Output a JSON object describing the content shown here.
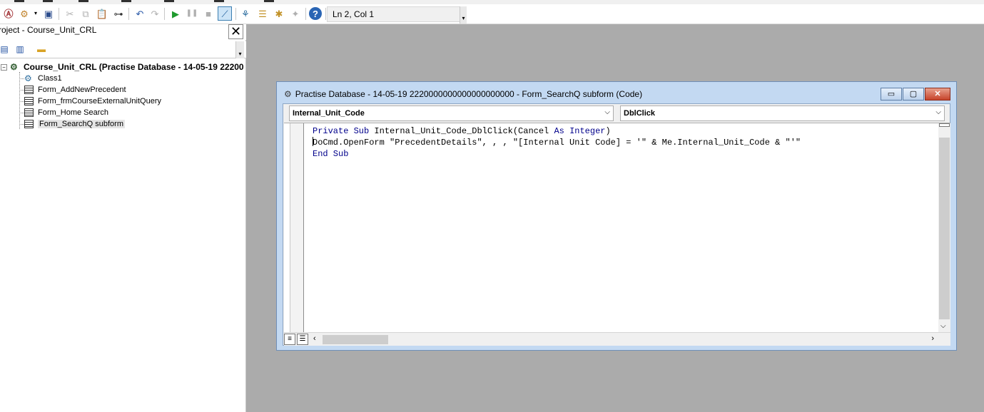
{
  "toolbar": {
    "buttons": [
      "access-icon",
      "insert-module-icon",
      "save-icon",
      "cut-icon",
      "copy-icon",
      "paste-icon",
      "find-icon",
      "undo-icon",
      "redo-icon",
      "run-icon",
      "break-icon",
      "reset-icon",
      "design-mode-icon",
      "project-explorer-icon",
      "properties-icon",
      "object-browser-icon",
      "toolbox-icon",
      "help-icon"
    ],
    "status": "Ln 2, Col 1"
  },
  "project": {
    "title": "roject - Course_Unit_CRL",
    "close_glyph": "✕",
    "root_label": "Course_Unit_CRL (Practise Database - 14-05-19 22200",
    "items": [
      {
        "label": "Class1",
        "icon": "class-module-icon"
      },
      {
        "label": "Form_AddNewPrecedent",
        "icon": "form-module-icon"
      },
      {
        "label": "Form_frmCourseExternalUnitQuery",
        "icon": "form-module-icon"
      },
      {
        "label": "Form_Home Search",
        "icon": "form-module-icon"
      },
      {
        "label": "Form_SearchQ subform",
        "icon": "form-module-icon",
        "selected": true
      }
    ]
  },
  "code_window": {
    "title": "Practise Database - 14-05-19 2220000000000000000000 - Form_SearchQ subform (Code)",
    "object_combo": "Internal_Unit_Code",
    "procedure_combo": "DblClick",
    "code_lines": [
      {
        "kw1": "Private Sub",
        "text1": " Internal_Unit_Code_DblClick(Cancel ",
        "kw2": "As",
        "text2": " ",
        "kw3": "Integer",
        "text3": ")"
      },
      {
        "text": "DoCmd.OpenForm \"PrecedentDetails\", , , \"[Internal Unit Code] = '\" & Me.Internal_Unit_Code & \"'\""
      },
      {
        "kw1": "End Sub"
      }
    ]
  },
  "colors": {
    "keyword": "#00008b",
    "workspace": "#ababab",
    "window_frame": "#c3d9f2",
    "close_button": "#c7432b"
  }
}
